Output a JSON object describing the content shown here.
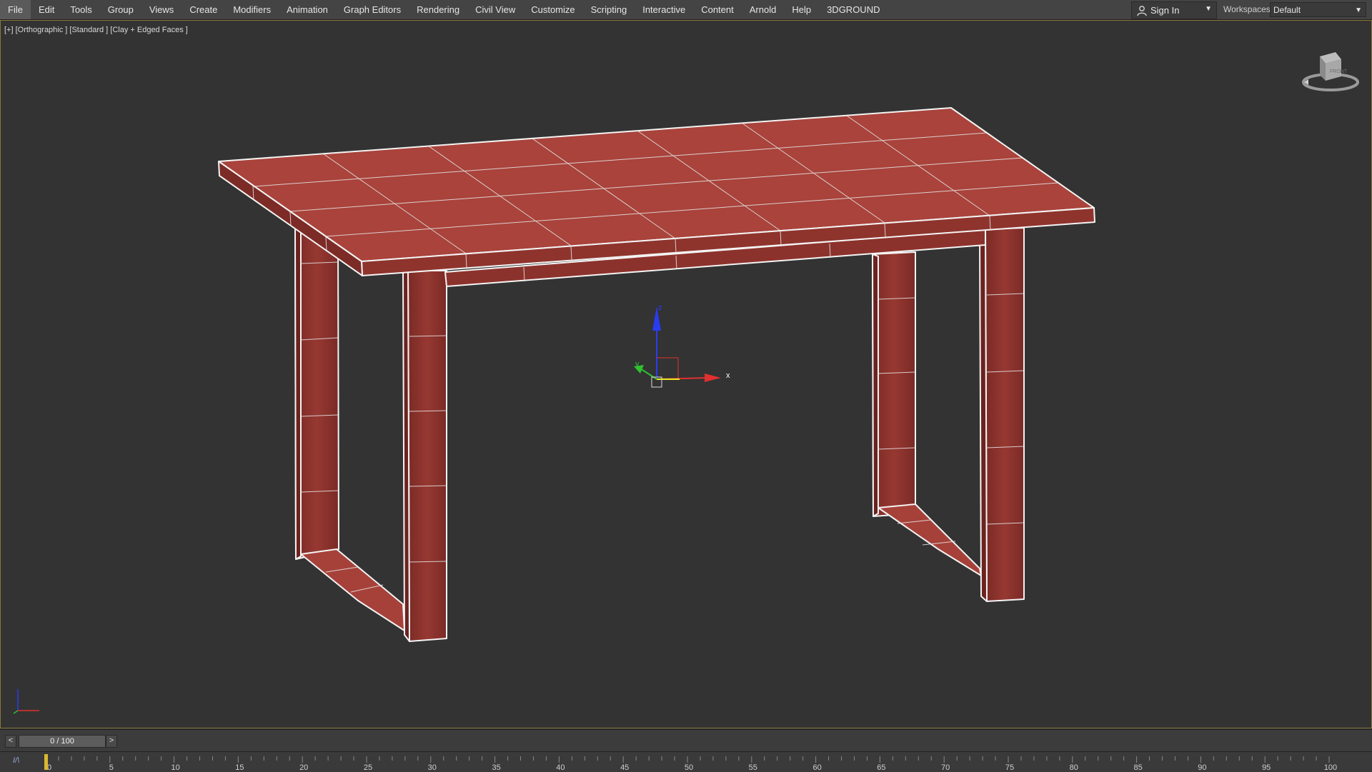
{
  "menu": {
    "items": [
      "File",
      "Edit",
      "Tools",
      "Group",
      "Views",
      "Create",
      "Modifiers",
      "Animation",
      "Graph Editors",
      "Rendering",
      "Civil View",
      "Customize",
      "Scripting",
      "Interactive",
      "Content",
      "Arnold",
      "Help",
      "3DGROUND"
    ],
    "active_index": 0
  },
  "account": {
    "sign_in_label": "Sign In",
    "workspaces_label": "Workspaces:",
    "workspace_value": "Default"
  },
  "viewport": {
    "label": "[+] [Orthographic ] [Standard ] [Clay + Edged Faces ]",
    "object_color": "#9b3b33",
    "gizmo_axis_x": "x",
    "gizmo_axis_y": "y",
    "gizmo_axis_z": "z",
    "viewcube_face": "FRONT"
  },
  "timeline": {
    "frame_display": "0 / 100",
    "prev_label": "<",
    "next_label": ">",
    "ticks": [
      "0",
      "5",
      "10",
      "15",
      "20",
      "25",
      "30",
      "35",
      "40",
      "45",
      "50",
      "55",
      "60",
      "65",
      "70",
      "75",
      "80",
      "85",
      "90",
      "95",
      "100"
    ],
    "curve_icon_label": "I/\\"
  },
  "colors": {
    "menubar_bg": "#444444",
    "viewport_bg": "#333333",
    "axis_x": "#e03030",
    "axis_y": "#30c030",
    "axis_z": "#2a3cf0"
  }
}
